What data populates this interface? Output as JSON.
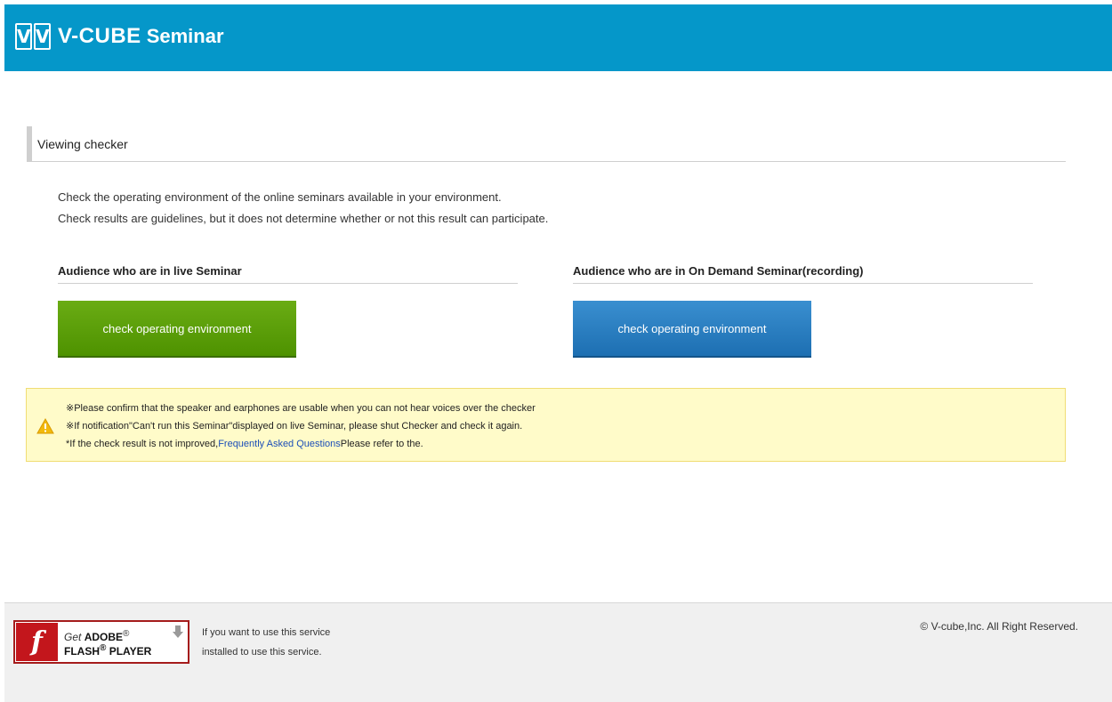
{
  "header": {
    "logo_letters": [
      "V",
      "V"
    ],
    "brand": "V-CUBE",
    "product": "Seminar",
    "bg_color": "#0597c9"
  },
  "section": {
    "title": "Viewing checker"
  },
  "description": {
    "line1": "Check the operating environment of the online seminars available in your environment.",
    "line2": "Check results are guidelines, but it does not determine whether or not this result can participate."
  },
  "live": {
    "heading": "Audience who are in live Seminar",
    "button_label": "check operating environment",
    "button_color": "#5a9e0a"
  },
  "on_demand": {
    "heading": "Audience who are in On Demand Seminar(recording)",
    "button_label": "check operating environment",
    "button_color": "#2a80c2"
  },
  "notice": {
    "icon": "warning-icon",
    "line1": "※Please confirm that the speaker and earphones are usable when you can not hear voices over the checker",
    "line2": "※If notification\"Can't run this Seminar\"displayed on live Seminar, please shut Checker and check it again.",
    "line3_prefix": "*If the check result is not improved,",
    "line3_link": "Frequently Asked Questions",
    "line3_suffix": "Please refer to the."
  },
  "footer": {
    "flash_get": "Get",
    "flash_adobe": "ADOBE",
    "flash_player": "FLASH",
    "flash_player_suffix": "PLAYER",
    "flash_logo_letter": "f",
    "note_line1": "If you want to use this service",
    "note_line2": "installed to use this service.",
    "copyright": "© V-cube,Inc. All Right Reserved."
  }
}
